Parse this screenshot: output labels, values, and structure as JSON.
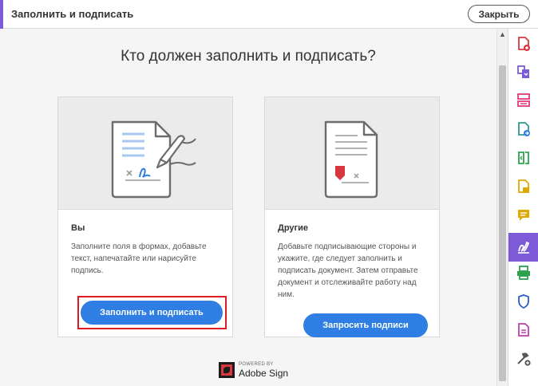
{
  "header": {
    "title": "Заполнить и подписать",
    "close_label": "Закрыть"
  },
  "main": {
    "heading": "Кто должен заполнить и подписать?",
    "cards": [
      {
        "title": "Вы",
        "description": "Заполните поля в формах, добавьте текст, напечатайте или нарисуйте подпись.",
        "button": "Заполнить и подписать"
      },
      {
        "title": "Другие",
        "description": "Добавьте подписывающие стороны и укажите, где следует заполнить и подписать документ. Затем отправьте документ и отслеживайте работу над ним.",
        "button": "Запросить подписи"
      }
    ],
    "powered_by": "POWERED BY",
    "brand": "Adobe Sign"
  },
  "colors": {
    "accent": "#7d5bd8",
    "primary_button": "#2e7ee3",
    "highlight": "#e01a22",
    "adobe_red": "#d7373f"
  },
  "right_rail": {
    "icons": [
      "create-pdf-icon",
      "combine-files-icon",
      "organize-pages-icon",
      "export-pdf-icon",
      "edit-pdf-icon",
      "rich-media-icon",
      "comment-icon",
      "fill-sign-icon",
      "scan-icon",
      "protect-icon",
      "document-icon",
      "more-tools-icon"
    ]
  }
}
